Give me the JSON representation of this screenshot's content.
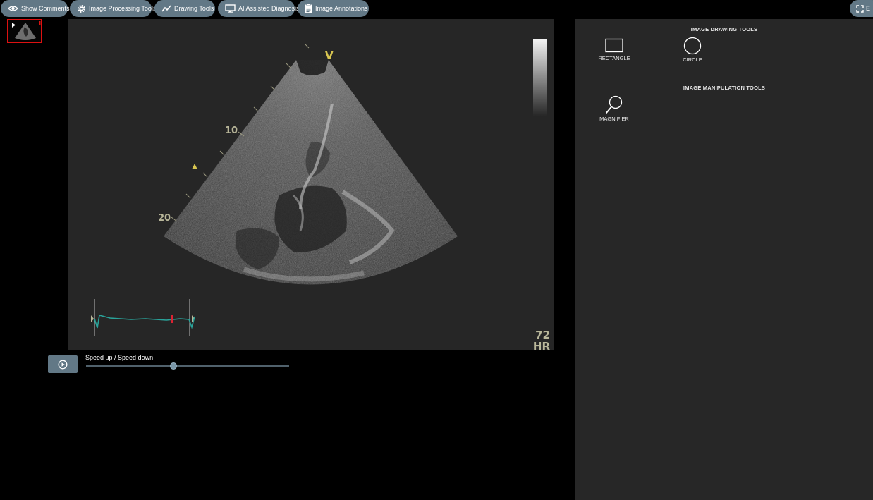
{
  "toolbar": {
    "show_comments": "Show Comments",
    "image_processing": "Image Processing Tools",
    "drawing_tools": "Drawing Tools",
    "ai_diagnosis": "AI Assisted Diagnosis",
    "image_annotations": "Image Annotations",
    "fullscreen": "E",
    "button_color": "#627886"
  },
  "viewer": {
    "marker_v": "V",
    "depth_10": "10",
    "depth_20": "20",
    "heart_rate_value": "72",
    "heart_rate_label": "HR",
    "ecg_color": "#2aa39a",
    "overlay_text_color": "#b9b79a"
  },
  "playback": {
    "speed_label": "Speed up / Speed down",
    "speed_level": 0.43
  },
  "panel": {
    "drawing_heading": "IMAGE DRAWING TOOLS",
    "manipulation_heading": "IMAGE MANIPULATION TOOLS",
    "rectangle_label": "RECTANGLE",
    "circle_label": "CIRCLE",
    "magnifier_label": "MAGNIFIER"
  }
}
